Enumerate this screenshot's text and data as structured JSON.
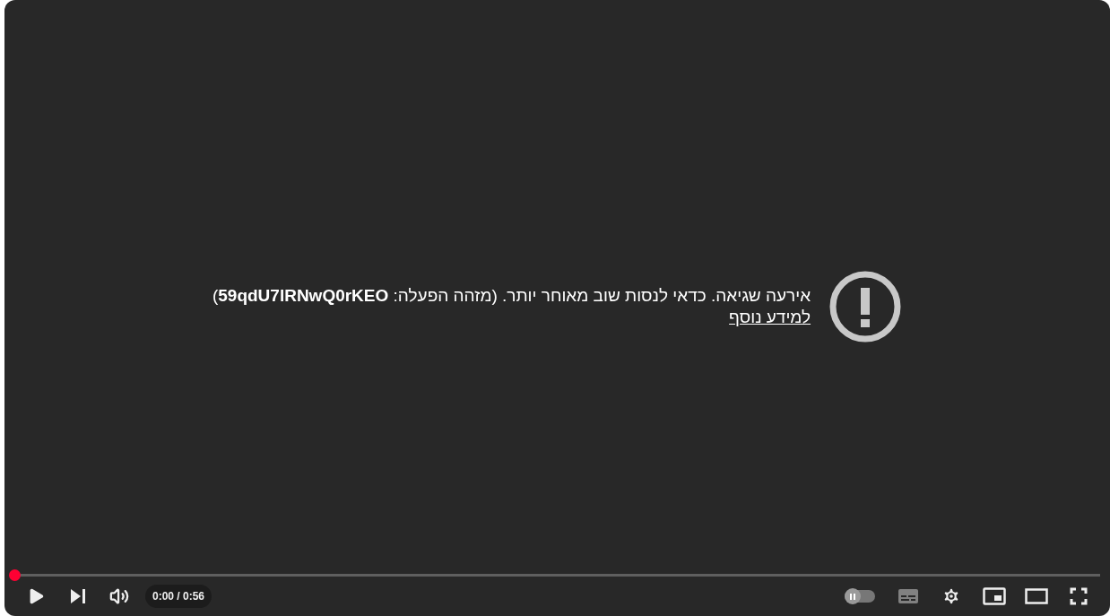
{
  "error": {
    "message": "אירעה שגיאה. כדאי לנסות שוב מאוחר יותר. (מזהה הפעלה: **59qdU7lRNwQ0rKEO**)",
    "link": "למידע נוסף"
  },
  "progress": {
    "level": 0
  },
  "time": "0:00 / 0:56",
  "autoplay": {
    "on": false
  },
  "subtitles": {
    "disabled": true
  }
}
